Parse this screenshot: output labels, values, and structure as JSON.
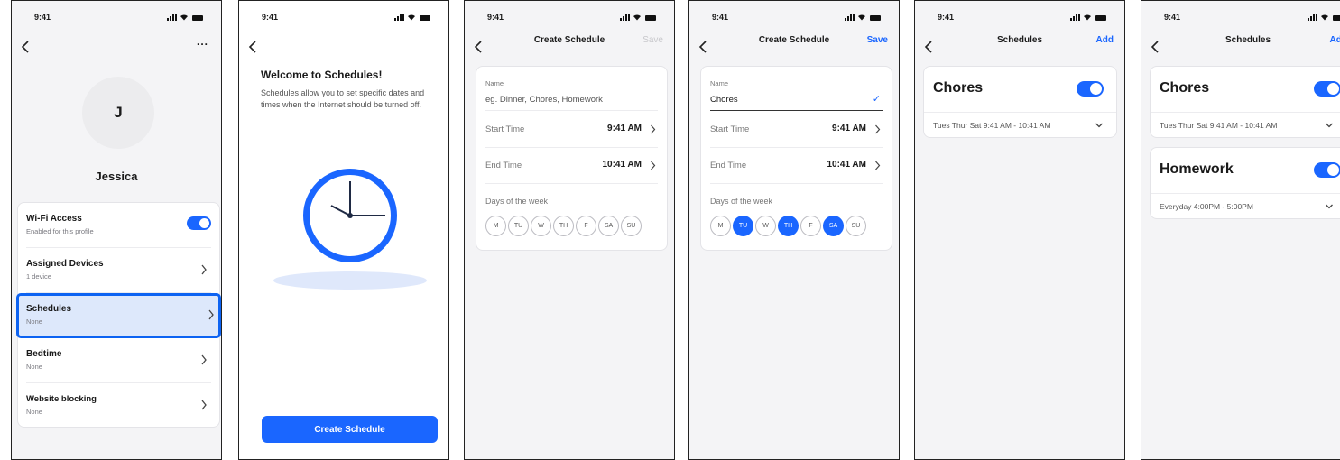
{
  "status_time": "9:41",
  "profile": {
    "avatar_initial": "J",
    "name": "Jessica",
    "more": "...",
    "rows": [
      {
        "title": "Wi-Fi Access",
        "subtitle": "Enabled for this profile"
      },
      {
        "title": "Assigned Devices",
        "subtitle": "1 device"
      },
      {
        "title": "Schedules",
        "subtitle": "None"
      },
      {
        "title": "Bedtime",
        "subtitle": "None"
      },
      {
        "title": "Website blocking",
        "subtitle": "None"
      }
    ]
  },
  "welcome": {
    "title": "Welcome to Schedules!",
    "text": "Schedules allow you to set specific dates and times when the Internet should be turned off.",
    "button": "Create Schedule"
  },
  "create_empty": {
    "title": "Create Schedule",
    "action": "Save",
    "name_label": "Name",
    "name_placeholder": "eg. Dinner, Chores, Homework",
    "start_label": "Start Time",
    "start_value": "9:41 AM",
    "end_label": "End Time",
    "end_value": "10:41 AM",
    "days_label": "Days of the week",
    "days": [
      "M",
      "TU",
      "W",
      "TH",
      "F",
      "SA",
      "SU"
    ]
  },
  "create_filled": {
    "title": "Create Schedule",
    "action": "Save",
    "name_label": "Name",
    "name_value": "Chores",
    "check": "✓",
    "start_label": "Start Time",
    "start_value": "9:41 AM",
    "end_label": "End Time",
    "end_value": "10:41 AM",
    "days_label": "Days of the week",
    "days": [
      "M",
      "TU",
      "W",
      "TH",
      "F",
      "SA",
      "SU"
    ],
    "selected_days": [
      "TU",
      "TH",
      "SA"
    ]
  },
  "schedules_one": {
    "title": "Schedules",
    "action": "Add",
    "items": [
      {
        "name": "Chores",
        "times": "Tues Thur Sat 9:41 AM - 10:41 AM"
      }
    ]
  },
  "schedules_two": {
    "title": "Schedules",
    "action": "Add",
    "items": [
      {
        "name": "Chores",
        "times": "Tues Thur Sat 9:41 AM - 10:41 AM"
      },
      {
        "name": "Homework",
        "times": "Everyday 4:00PM - 5:00PM"
      }
    ]
  },
  "colors": {
    "accent": "#1a66ff",
    "highlight_border": "#0d63f2",
    "highlight_fill": "#dde8fb"
  }
}
